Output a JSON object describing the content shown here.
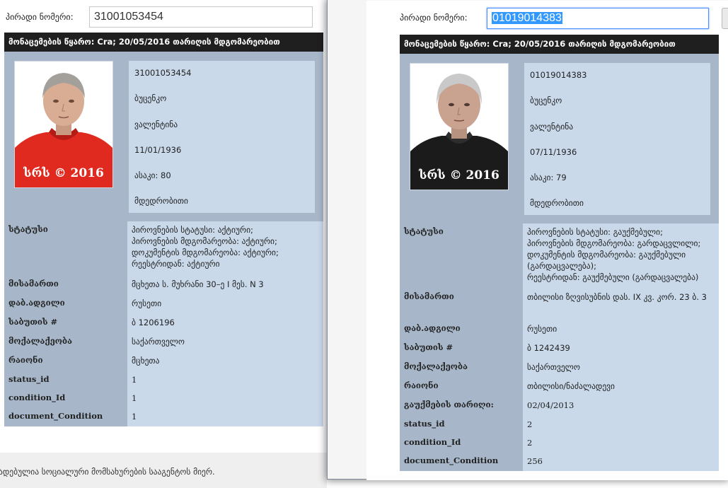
{
  "left": {
    "id_label": "პირადი ნომერი:",
    "id_value": "31001053454",
    "header": "მონაცემების წყარო: Cra; 20/05/2016 თარიღის მდგომარეობით",
    "photo_watermark": "სრს © 2016",
    "info": [
      "31001053454",
      "ბუცენკო",
      "ვალენტინა",
      "11/01/1936",
      "ასაკი: 80",
      "მდედრობითი"
    ],
    "rows": [
      {
        "key": "სტატუსი",
        "value": [
          "პიროვნების სტატუსი: აქტიური;",
          "პიროვნების მდგომარეობა: აქტიური;",
          "დოკუმენტის მდგომარეობა: აქტიური;",
          "რეესტრიდან: აქტიური"
        ]
      },
      {
        "key": "მისამართი",
        "value": [
          "მცხეთა ს. მუხრანი 30–ე I მეს. N 3"
        ]
      },
      {
        "key": "დაბ.ადგილი",
        "value": [
          "რუსეთი"
        ]
      },
      {
        "key": "საბუთის #",
        "value": [
          "ბ 1206196"
        ]
      },
      {
        "key": "მოქალაქეობა",
        "value": [
          "საქართველო"
        ]
      },
      {
        "key": "რაიონი",
        "value": [
          "მცხეთა"
        ]
      },
      {
        "key": "status_id",
        "value": [
          "1"
        ]
      },
      {
        "key": "condition_Id",
        "value": [
          "1"
        ]
      },
      {
        "key": "document_Condition",
        "value": [
          "1"
        ]
      }
    ],
    "footer": "ადებულია სოციალური მომსახურების სააგენტოს მიერ."
  },
  "right": {
    "id_label": "პირადი ნომერი:",
    "id_value": "01019014383",
    "header": "მონაცემების წყარო: Cra; 20/05/2016 თარიღის მდგომარეობით",
    "photo_watermark": "სრს © 2016",
    "info": [
      "01019014383",
      "ბუცენკო",
      "ვალენტინა",
      "07/11/1936",
      "ასაკი: 79",
      "მდედრობითი"
    ],
    "rows": [
      {
        "key": "სტატუსი",
        "value": [
          "პიროვნების სტატუსი: გაუქმებული;",
          "პიროვნების მდგომარეობა: გარდაცვლილი;",
          "დოკუმენტის მდგომარეობა: გაუქმებული (გარდაცვალება);",
          "რეესტრიდან: გაუქმებული (გარდაცვალება)"
        ]
      },
      {
        "key": "მისამართი",
        "value": [
          "თბილისი ზღვისუბნის დას. IX კვ. კორ. 23 ბ. 3"
        ]
      },
      {
        "key": "დაბ.ადგილი",
        "value": [
          "რუსეთი"
        ]
      },
      {
        "key": "საბუთის #",
        "value": [
          "ბ 1242439"
        ]
      },
      {
        "key": "მოქალაქეობა",
        "value": [
          "საქართველო"
        ]
      },
      {
        "key": "რაიონი",
        "value": [
          "თბილისი/ნაძალადევი"
        ]
      },
      {
        "key": "გაუქმების თარიღი:",
        "value": [
          "02/04/2013"
        ]
      },
      {
        "key": "status_id",
        "value": [
          "2"
        ]
      },
      {
        "key": "condition_Id",
        "value": [
          "2"
        ]
      },
      {
        "key": "document_Condition",
        "value": [
          "256"
        ]
      }
    ]
  },
  "colors": {
    "header_bg": "#1f1f1f",
    "key_bg": "#a7b7c9",
    "value_bg": "#c9d9ea",
    "selection": "#3399ff",
    "left_sweater": "#e02a20",
    "right_sweater": "#1b1b1b"
  }
}
